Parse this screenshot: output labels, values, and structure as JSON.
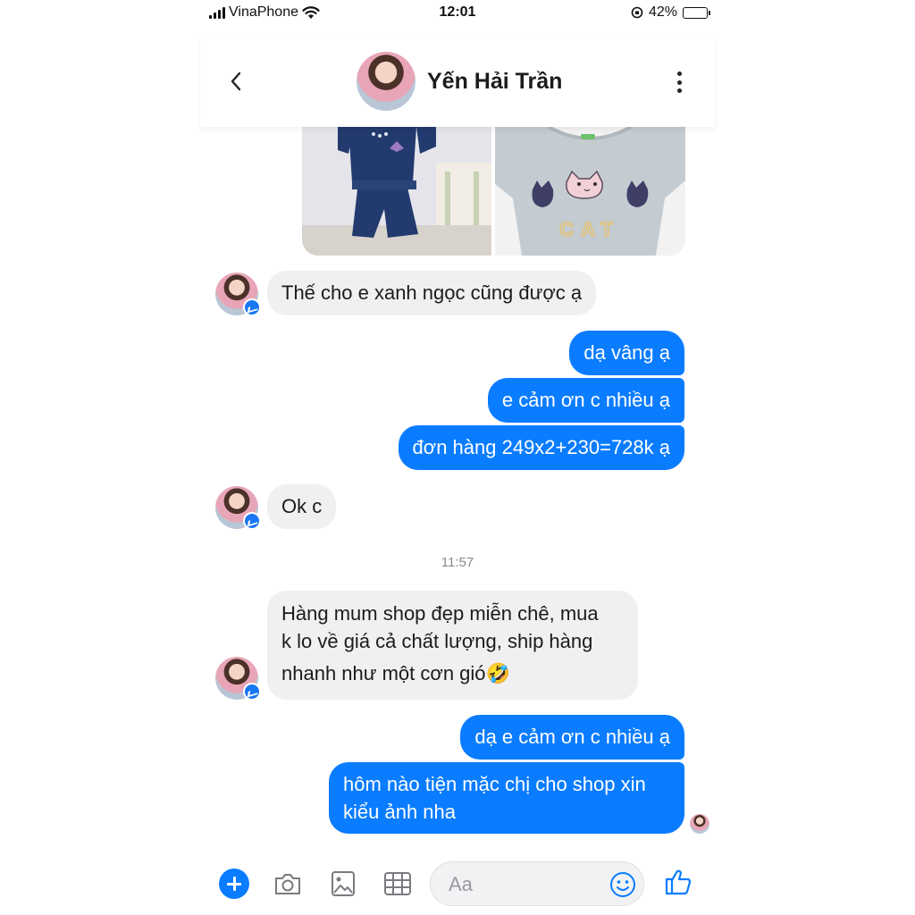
{
  "status_bar": {
    "carrier": "VinaPhone",
    "time": "12:01",
    "battery": "42%",
    "battery_level": 0.42
  },
  "header": {
    "contact_name": "Yến Hải Trần"
  },
  "messages": {
    "m1": "Thế cho e xanh ngọc cũng được ạ",
    "m2": "dạ vâng ạ",
    "m3": "e cảm ơn c nhiều ạ",
    "m4": "đơn hàng 249x2+230=728k ạ",
    "m5": "Ok c",
    "timestamp": "11:57",
    "m6_line1": "Hàng mum shop đẹp miễn chê, mua",
    "m6_line2": "k lo về giá cả chất lượng, ship hàng",
    "m6_line3": "nhanh như một cơn gió🤣",
    "m7": "dạ e cảm ơn c nhiều ạ",
    "m8_line1": "hôm nào tiện mặc chị cho shop xin",
    "m8_line2": "kiểu ảnh nha"
  },
  "photo2_print": "CAT",
  "composer": {
    "placeholder": "Aa"
  },
  "colors": {
    "accent": "#0a7cff",
    "incoming_bubble": "#f0f0f0"
  },
  "icons": [
    "signal-icon",
    "wifi-icon",
    "orientation-lock-icon",
    "battery-icon",
    "back-icon",
    "more-icon",
    "messenger-badge-icon",
    "plus-icon",
    "camera-icon",
    "gallery-icon",
    "gif-icon",
    "smile-icon",
    "like-icon"
  ]
}
